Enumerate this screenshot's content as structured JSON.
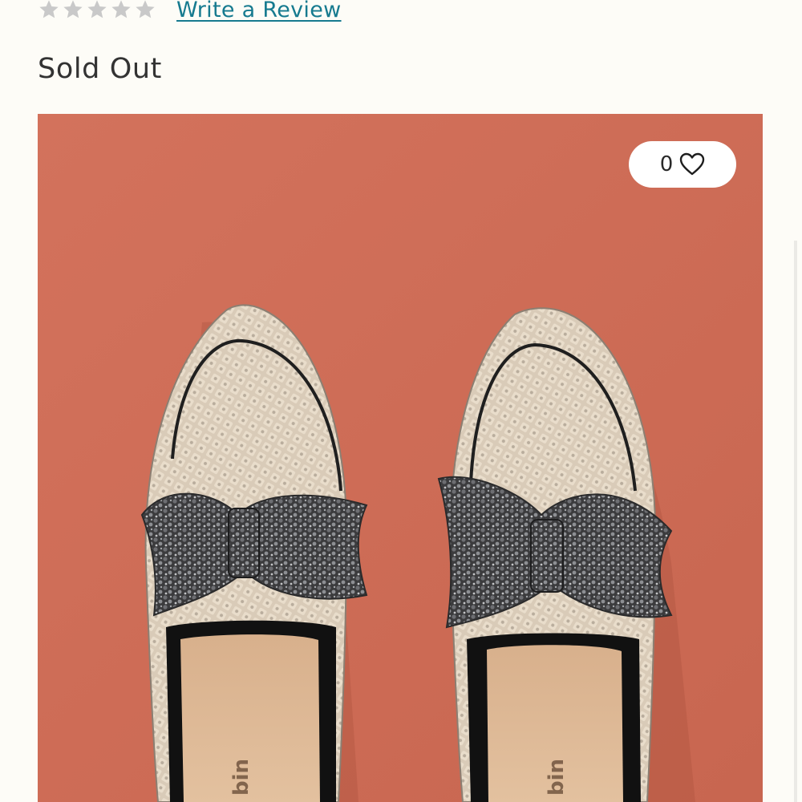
{
  "rating": {
    "stars_filled": 0,
    "stars_total": 5,
    "star_color": "#c9c9c9",
    "write_review_label": "Write a Review",
    "link_color": "#167a8f"
  },
  "availability": {
    "status_text": "Sold Out"
  },
  "product_image": {
    "background_color": "#cf6d57",
    "like_count": "0",
    "like_icon": "heart-outline-icon"
  }
}
